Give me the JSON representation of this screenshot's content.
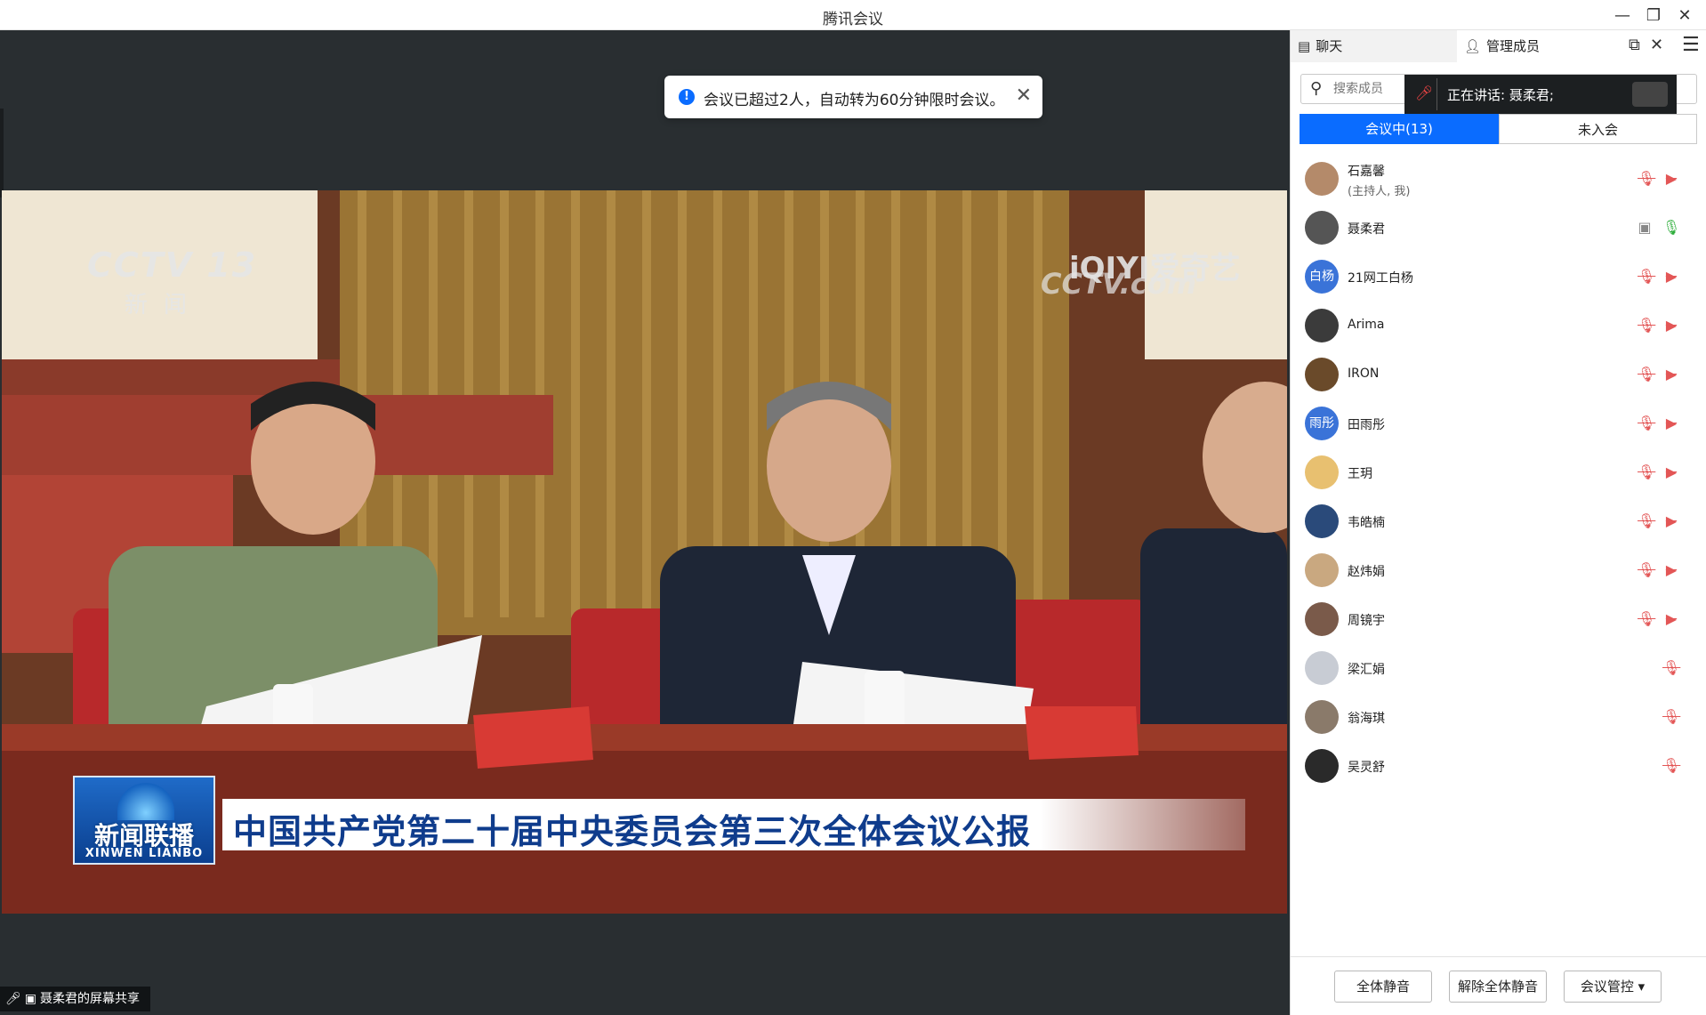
{
  "window": {
    "title": "腾讯会议",
    "minimize": "—",
    "restore": "❐",
    "close": "✕"
  },
  "toast": {
    "message": "会议已超过2人，自动转为60分钟限时会议。",
    "icon": "!",
    "close": "✕"
  },
  "video": {
    "channel_logo": "CCTV 13",
    "channel_sub": "新闻",
    "watermark_1": "iQIYI爱奇艺",
    "watermark_2": "CCTV.com",
    "program_cn": "新闻联播",
    "program_en": "XINWEN LIANBO",
    "headline": "中国共产党第二十届中央委员会第三次全体会议公报"
  },
  "share_label": "聂柔君的屏幕共享",
  "panel": {
    "tabs": {
      "chat": "聊天",
      "members": "管理成员"
    },
    "search_placeholder": "搜索成员",
    "speaking": "正在讲话:  聂柔君;",
    "segments": {
      "in_meeting": "会议中(13)",
      "not_joined": "未入会"
    },
    "members": [
      {
        "name": "石嘉馨",
        "sub": "(主持人, 我)",
        "avatar_text": "",
        "avatar_color": "#b48a6a",
        "mic": "muted",
        "cam": "off"
      },
      {
        "name": "聂柔君",
        "sub": "",
        "avatar_text": "",
        "avatar_color": "#555555",
        "mic": "live",
        "cam": "screen"
      },
      {
        "name": "21网工白杨",
        "sub": "",
        "avatar_text": "白杨",
        "avatar_color": "#3a73d8",
        "mic": "muted",
        "cam": "off"
      },
      {
        "name": "Arima",
        "sub": "",
        "avatar_text": "",
        "avatar_color": "#3b3b3b",
        "mic": "muted",
        "cam": "off"
      },
      {
        "name": "IRON",
        "sub": "",
        "avatar_text": "",
        "avatar_color": "#6a4a2a",
        "mic": "muted",
        "cam": "off"
      },
      {
        "name": "田雨彤",
        "sub": "",
        "avatar_text": "雨彤",
        "avatar_color": "#3a73d8",
        "mic": "muted",
        "cam": "off"
      },
      {
        "name": "王玥",
        "sub": "",
        "avatar_text": "",
        "avatar_color": "#e8c070",
        "mic": "muted",
        "cam": "off"
      },
      {
        "name": "韦皓楠",
        "sub": "",
        "avatar_text": "",
        "avatar_color": "#2a4a7a",
        "mic": "muted",
        "cam": "off"
      },
      {
        "name": "赵炜娟",
        "sub": "",
        "avatar_text": "",
        "avatar_color": "#c9a880",
        "mic": "muted",
        "cam": "off"
      },
      {
        "name": "周镜宇",
        "sub": "",
        "avatar_text": "",
        "avatar_color": "#7a5a4a",
        "mic": "muted",
        "cam": "off"
      },
      {
        "name": "梁汇娟",
        "sub": "",
        "avatar_text": "",
        "avatar_color": "#c8ccd4",
        "mic": "muted",
        "cam": "none"
      },
      {
        "name": "翁海琪",
        "sub": "",
        "avatar_text": "",
        "avatar_color": "#8a7a6a",
        "mic": "muted",
        "cam": "none"
      },
      {
        "name": "吴灵舒",
        "sub": "",
        "avatar_text": "",
        "avatar_color": "#2a2a2a",
        "mic": "muted",
        "cam": "none"
      }
    ],
    "footer": {
      "mute_all": "全体静音",
      "unmute_all": "解除全体静音",
      "meeting_control": "会议管控 ▾"
    }
  },
  "colors": {
    "accent": "#0a6cff",
    "stage_bg": "#292e31"
  }
}
